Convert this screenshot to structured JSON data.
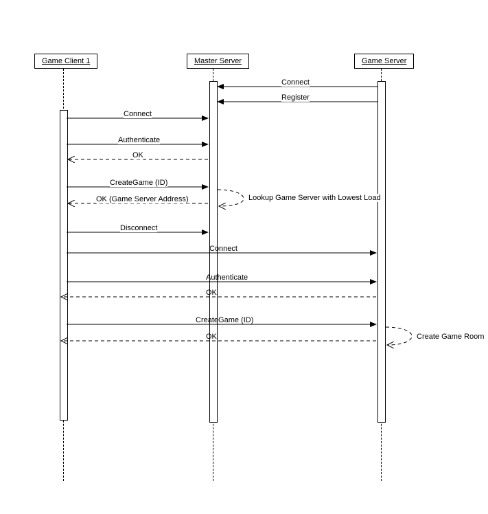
{
  "participants": {
    "client": "Game Client 1",
    "master": "Master Server",
    "game": "Game Server"
  },
  "messages": {
    "m1": "Connect",
    "m2": "Register",
    "m3": "Connect",
    "m4": "Authenticate",
    "m5": "OK",
    "m6": "CreateGame (ID)",
    "m7": "OK (Game Server Address)",
    "m8": "Disconnect",
    "m9": "Connect",
    "m10": "Authenticate",
    "m11": "OK",
    "m12": "CreateGame (ID)",
    "m13": "OK"
  },
  "notes": {
    "n1": "Lookup Game Server with Lowest Load",
    "n2": "Create Game Room"
  }
}
